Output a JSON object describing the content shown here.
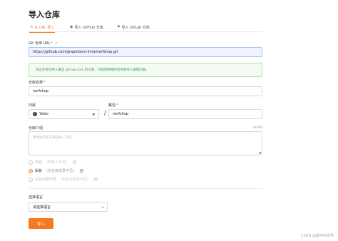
{
  "page": {
    "title": "导入仓库"
  },
  "tabs": [
    {
      "icon": "⊙",
      "label": "从 URL 导入",
      "active": true
    },
    {
      "icon": "◉",
      "label": "导入 GitHub 仓库",
      "active": false
    },
    {
      "icon": "⚑",
      "label": "导入 GitLab 仓库",
      "active": false
    }
  ],
  "git_url": {
    "label": "Git 仓库 URL",
    "required": "*",
    "valid_mark": "✓",
    "value": "https://github.com/graphdeco-inria/nerfshop.git"
  },
  "alert": {
    "text": "你正在尝试导入来自 github.com 的仓库，可能因网络原因导致导入缓慢问题。"
  },
  "repo_name": {
    "label": "仓库名称",
    "required": "*",
    "value": "nerfshop"
  },
  "owner": {
    "label": "归属",
    "avatar": "Y",
    "value": "Yoker",
    "caret": "▼"
  },
  "path": {
    "label": "路径",
    "required": "*",
    "value": "nerfshop",
    "separator": "/"
  },
  "description": {
    "label": "仓库介绍",
    "counter": "0/200",
    "placeholder": "用简短的语言来描述一下吧"
  },
  "visibility": [
    {
      "label": "开源",
      "desc": "（所有人可见）",
      "checked": false,
      "disabled": true
    },
    {
      "label": "私有",
      "desc": "（仅仓库成员可见）",
      "checked": true,
      "disabled": false
    },
    {
      "label": "企业内部开源",
      "desc": "（仅企业成员可见）",
      "checked": false,
      "disabled": true
    }
  ],
  "language": {
    "label": "选择语言",
    "placeholder": "请选择语言",
    "caret": "▾"
  },
  "actions": {
    "import_label": "导入"
  },
  "watermark": "CSDN @躺平的世界"
}
